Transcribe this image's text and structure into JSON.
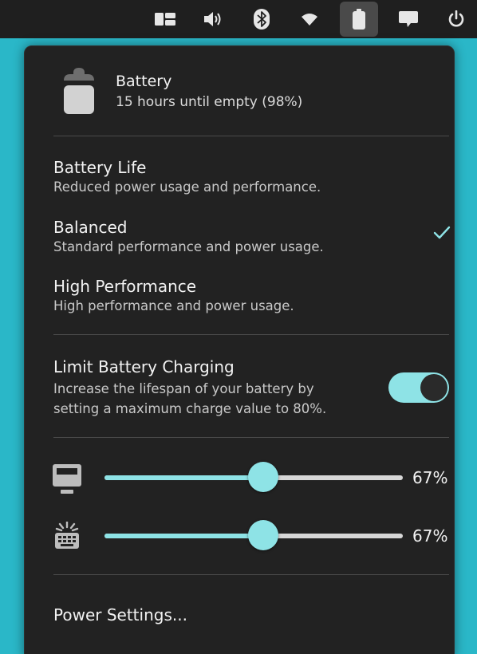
{
  "topbar": {
    "icons": [
      "window-switcher-icon",
      "volume-icon",
      "bluetooth-icon",
      "wifi-icon",
      "battery-icon",
      "notifications-icon",
      "power-icon"
    ],
    "active_icon": "battery-icon"
  },
  "battery": {
    "title": "Battery",
    "status": "15 hours until empty (98%)",
    "icon": "battery-icon"
  },
  "power_modes": [
    {
      "title": "Battery Life",
      "description": "Reduced power usage and performance.",
      "selected": false
    },
    {
      "title": "Balanced",
      "description": "Standard performance and power usage.",
      "selected": true
    },
    {
      "title": "High Performance",
      "description": "High performance and power usage.",
      "selected": false
    }
  ],
  "limit_charging": {
    "title": "Limit Battery Charging",
    "description": "Increase the lifespan of your battery by setting a maximum charge value to 80%.",
    "enabled": true
  },
  "sliders": [
    {
      "icon": "display-brightness-icon",
      "value": 67,
      "label": "67%"
    },
    {
      "icon": "keyboard-backlight-icon",
      "value": 67,
      "label": "67%"
    }
  ],
  "footer": {
    "power_settings": "Power Settings..."
  },
  "colors": {
    "accent": "#8ee3e6",
    "popover_bg": "#222222",
    "topbar_bg": "#1f1f1f",
    "desktop_bg": "#2ab7c8"
  }
}
